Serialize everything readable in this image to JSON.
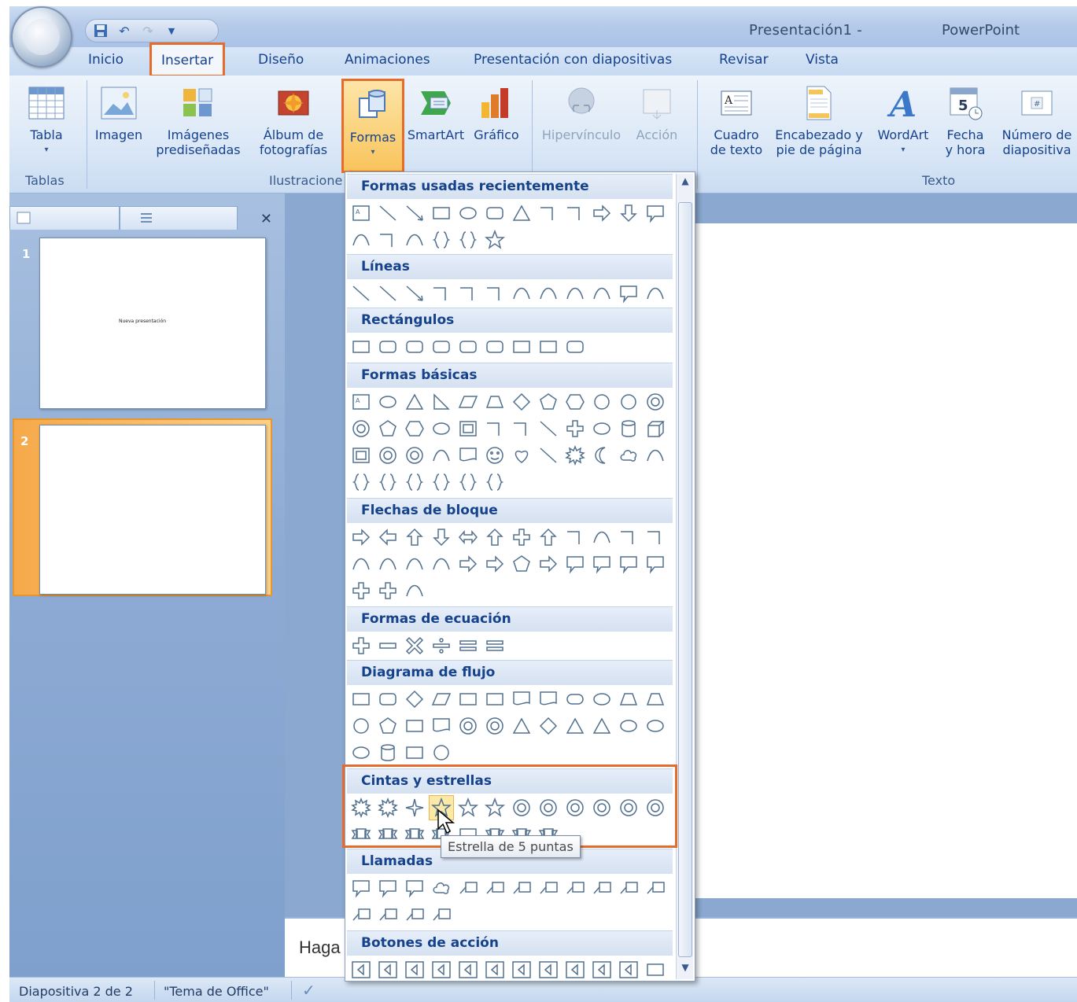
{
  "window": {
    "title_doc": "Presentación1 -",
    "title_app": "PowerPoint"
  },
  "tabs": [
    "Inicio",
    "Insertar",
    "Diseño",
    "Animaciones",
    "Presentación con diapositivas",
    "Revisar",
    "Vista"
  ],
  "ribbon": {
    "tabla": "Tabla",
    "imagen": "Imagen",
    "imagenes_1": "Imágenes",
    "imagenes_2": "prediseñadas",
    "album_1": "Álbum de",
    "album_2": "fotografías",
    "formas": "Formas",
    "smartart": "SmartArt",
    "grafico": "Gráfico",
    "hipervinculo": "Hipervínculo",
    "accion": "Acción",
    "cuadro_1": "Cuadro",
    "cuadro_2": "de texto",
    "encabezado_1": "Encabezado y",
    "encabezado_2": "pie de página",
    "wordart": "WordArt",
    "fecha_1": "Fecha",
    "fecha_2": "y hora",
    "numero_1": "Número de",
    "numero_2": "diapositiva",
    "group_tablas": "Tablas",
    "group_ilustraciones": "Ilustracione",
    "group_texto": "Texto"
  },
  "slides": {
    "num1": "1",
    "num2": "2",
    "thumb1_text": "Nueva presentación"
  },
  "notes_placeholder": "Haga",
  "status": {
    "slide_info": "Diapositiva 2 de 2",
    "theme": "\"Tema de Office\""
  },
  "shapes_menu": {
    "cat_recientes": "Formas usadas recientemente",
    "cat_lineas": "Líneas",
    "cat_rectangulos": "Rectángulos",
    "cat_basicas": "Formas básicas",
    "cat_flechas": "Flechas de bloque",
    "cat_ecuacion": "Formas de ecuación",
    "cat_flujo": "Diagrama de flujo",
    "cat_cintas": "Cintas y estrellas",
    "cat_llamadas": "Llamadas",
    "cat_botones": "Botones de acción"
  },
  "tooltip": "Estrella de 5 puntas",
  "colors": {
    "highlight": "#e46c2d",
    "ribbon_text": "#15428b"
  }
}
